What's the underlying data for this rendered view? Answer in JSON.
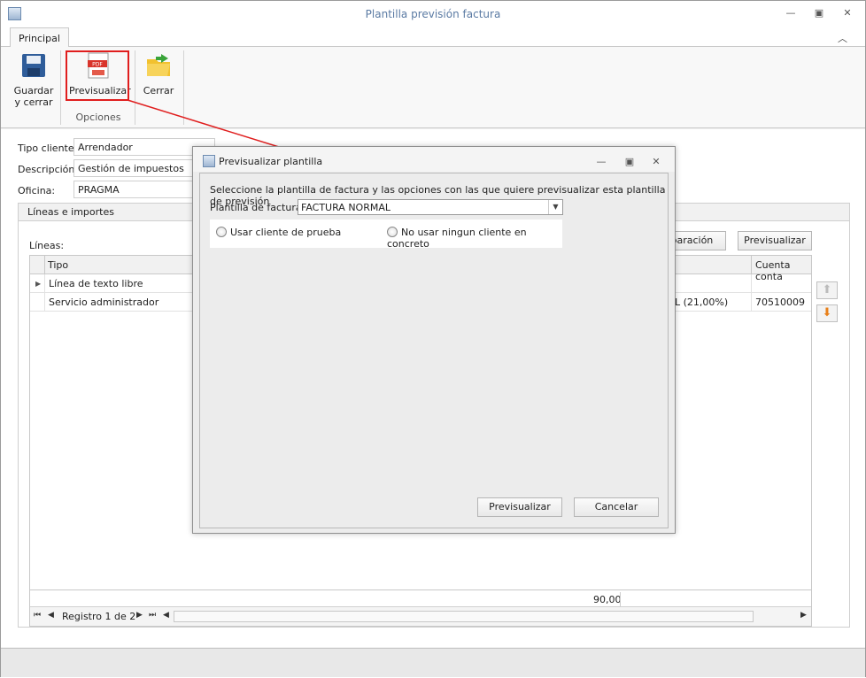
{
  "window": {
    "title": "Plantilla previsión factura"
  },
  "ribbon": {
    "tab": "Principal",
    "buttons": {
      "guardar": "Guardar y cerrar",
      "previsualizar": "Previsualizar",
      "cerrar": "Cerrar"
    },
    "group_label": "Opciones"
  },
  "form": {
    "tipo_cliente": {
      "label": "Tipo cliente:",
      "value": "Arrendador"
    },
    "descripcion": {
      "label": "Descripción:",
      "value": "Gestión de impuestos"
    },
    "oficina": {
      "label": "Oficina:",
      "value": "PRAGMA"
    }
  },
  "lines_group": {
    "title": "Líneas e importes",
    "lines_label": "Líneas:",
    "buttons": {
      "separacion": "eparación",
      "previsualizar": "Previsualizar"
    },
    "columns": {
      "tipo": "Tipo",
      "cuenta": "Cuenta conta"
    },
    "rows": [
      {
        "tipo": "Línea de texto libre",
        "iva": "",
        "cuenta": ""
      },
      {
        "tipo": "Servicio administrador",
        "iva": "L (21,00%)",
        "cuenta": "70510009"
      }
    ],
    "total": "90,00",
    "navigator": "Registro 1 de 2"
  },
  "dialog": {
    "title": "Previsualizar plantilla",
    "instruction": "Seleccione la plantilla de factura y las opciones con las que quiere previsualizar esta plantilla de previsión",
    "plantilla_label": "Plantilla de factura:",
    "plantilla_value": "FACTURA NORMAL",
    "radio_prueba": "Usar cliente de prueba",
    "radio_ninguno": "No usar ningun cliente en concreto",
    "btn_previsualizar": "Previsualizar",
    "btn_cancelar": "Cancelar"
  },
  "colors": {
    "title_text": "#5a7aa3",
    "highlight_box": "#e01e1e",
    "arrow": "#e01e1e"
  }
}
